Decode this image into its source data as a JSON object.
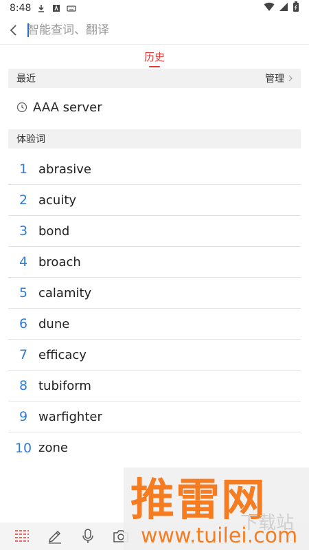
{
  "status_bar": {
    "time": "8:48"
  },
  "search": {
    "placeholder": "智能查词、翻译"
  },
  "tabs": [
    {
      "label": "历史",
      "active": true
    }
  ],
  "recent": {
    "title": "最近",
    "manage_label": "管理",
    "items": [
      {
        "text": "AAA server"
      }
    ]
  },
  "trial": {
    "title": "体验词",
    "words": [
      {
        "num": "1",
        "word": "abrasive"
      },
      {
        "num": "2",
        "word": "acuity"
      },
      {
        "num": "3",
        "word": "bond"
      },
      {
        "num": "4",
        "word": "broach"
      },
      {
        "num": "5",
        "word": "calamity"
      },
      {
        "num": "6",
        "word": "dune"
      },
      {
        "num": "7",
        "word": "efficacy"
      },
      {
        "num": "8",
        "word": "tubiform"
      },
      {
        "num": "9",
        "word": "warfighter"
      },
      {
        "num": "10",
        "word": "zone"
      }
    ]
  },
  "watermark": {
    "brand": "推雷网",
    "url": "www.tuilei.com",
    "extra": "下载站"
  },
  "colors": {
    "accent_red": "#e53935",
    "number_blue": "#2e7bd6",
    "watermark_orange": "#f57c20"
  }
}
